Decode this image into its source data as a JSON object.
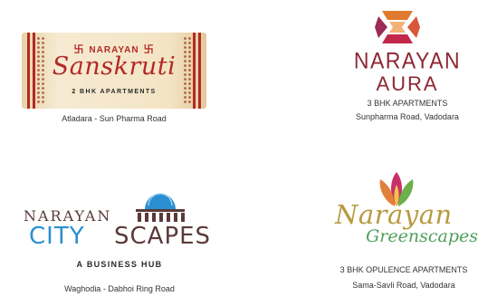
{
  "projects": [
    {
      "brand": "NARAYAN",
      "name": "Sanskruti",
      "subtitle": "2 BHK APARTMENTS",
      "location": "Atladara - Sun Pharma Road",
      "colors": {
        "primary": "#b22a25",
        "background": "#f3e4c4"
      },
      "icon": "swastik-icon"
    },
    {
      "brand": "NARAYAN",
      "name": "AURA",
      "subtitle": "3 BHK APARTMENTS",
      "location": "Sunpharma Road, Vadodara",
      "colors": {
        "primary": "#8d2733",
        "accent": "#e07a2e"
      },
      "icon": "ribbon-knot-icon"
    },
    {
      "brand": "NARAYAN",
      "name_part1": "CITY",
      "name_part2": "SCAPES",
      "subtitle": "A BUSINESS HUB",
      "location": "Waghodia - Dabhoi Ring Road",
      "colors": {
        "primary": "#2a8fd0",
        "secondary": "#5a3a3a"
      },
      "icon": "dome-building-icon"
    },
    {
      "brand": "Narayan",
      "name": "Greenscapes",
      "subtitle": "3 BHK OPULENCE APARTMENTS",
      "location": "Sama-Savli Road, Vadodara",
      "colors": {
        "primary": "#b79a3f",
        "secondary": "#4d9f5a",
        "accent": "#c8306a"
      },
      "icon": "lotus-icon"
    }
  ]
}
